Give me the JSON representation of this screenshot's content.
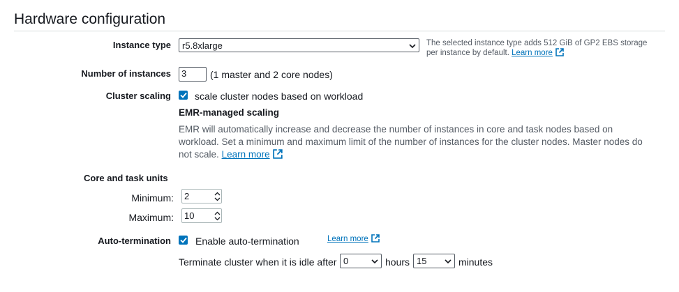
{
  "section": {
    "title": "Hardware configuration"
  },
  "instance_type": {
    "label": "Instance type",
    "value": "r5.8xlarge",
    "note_text": "The selected instance type adds 512 GiB of GP2 EBS storage per instance by default.",
    "note_link": "Learn more"
  },
  "instances": {
    "label": "Number of instances",
    "value": "3",
    "note": "(1 master and 2 core nodes)"
  },
  "cluster_scaling": {
    "label": "Cluster scaling",
    "checked": true,
    "checkbox_label": "scale cluster nodes based on workload",
    "managed_heading": "EMR-managed scaling",
    "description": "EMR will automatically increase and decrease the number of instances in core and task nodes based on workload. Set a minimum and maximum limit of the number of instances for the cluster nodes. Master nodes do not scale.",
    "learn_more": "Learn more"
  },
  "units": {
    "heading": "Core and task units",
    "minimum_label": "Minimum:",
    "minimum_value": "2",
    "maximum_label": "Maximum:",
    "maximum_value": "10"
  },
  "auto_termination": {
    "label": "Auto-termination",
    "checked": true,
    "checkbox_label": "Enable auto-termination",
    "learn_more": "Learn more",
    "idle_prefix": "Terminate cluster when it is idle after",
    "hours_value": "0",
    "hours_label": "hours",
    "minutes_value": "15",
    "minutes_label": "minutes"
  },
  "colors": {
    "accent": "#0073bb",
    "text": "#16191f",
    "muted": "#545b64"
  }
}
